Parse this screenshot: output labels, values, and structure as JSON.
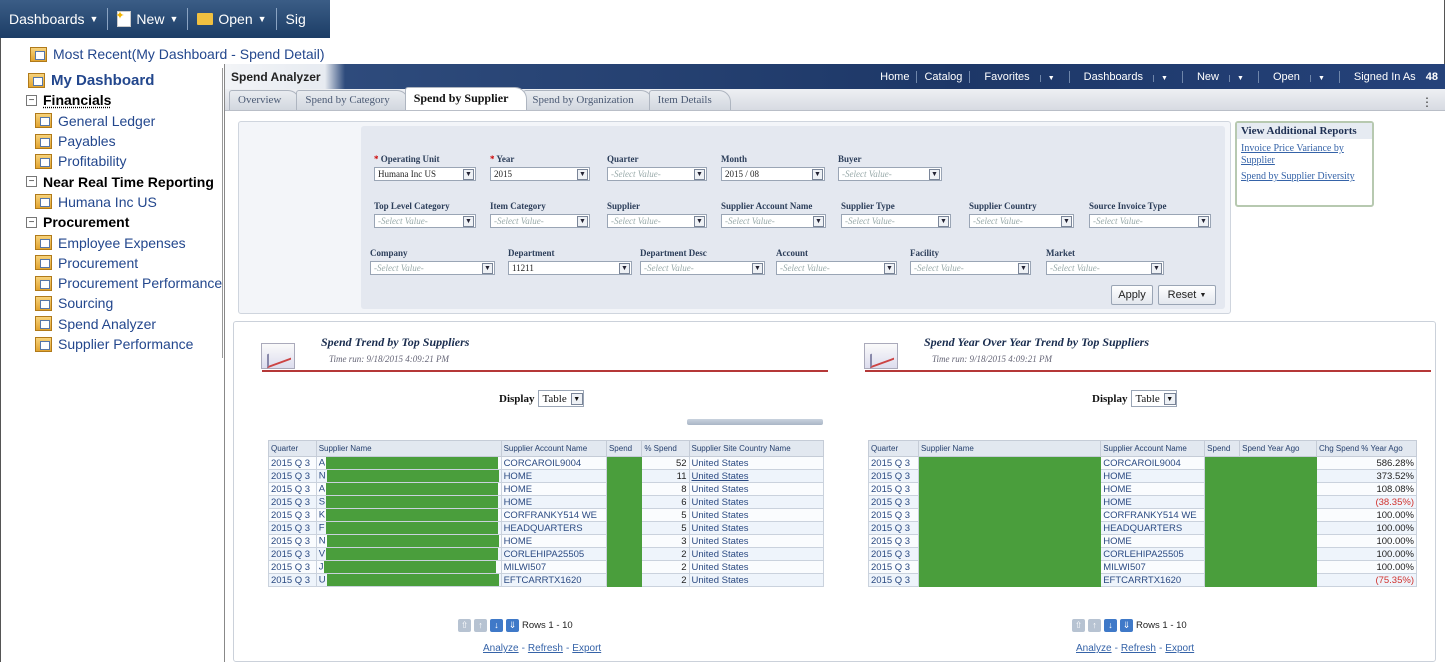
{
  "toolbar": {
    "dashboards": "Dashboards",
    "new": "New",
    "open": "Open",
    "signed_in": "Sig"
  },
  "most_recent": "Most Recent(My Dashboard - Spend Detail)",
  "tree": {
    "my_dashboard": "My Dashboard",
    "groups": [
      {
        "label": "Financials",
        "items": [
          "General Ledger",
          "Payables",
          "Profitability"
        ]
      },
      {
        "label": "Near Real Time Reporting",
        "items": [
          "Humana Inc US"
        ]
      },
      {
        "label": "Procurement",
        "items": [
          "Employee Expenses",
          "Procurement",
          "Procurement Performance",
          "Sourcing",
          "Spend Analyzer",
          "Supplier Performance"
        ]
      }
    ]
  },
  "analyzer": {
    "title": "Spend Analyzer",
    "nav": {
      "home": "Home",
      "catalog": "Catalog",
      "favorites": "Favorites",
      "dashboards": "Dashboards",
      "new": "New",
      "open": "Open",
      "signed_in": "Signed In As",
      "user_fragment": "48"
    },
    "tabs": [
      "Overview",
      "Spend by Category",
      "Spend by Supplier",
      "Spend by Organization",
      "Item Details"
    ],
    "active_tab": "Spend by Supplier"
  },
  "prompts": {
    "placeholder": "-Select Value-",
    "row1": [
      {
        "label": "Operating Unit",
        "required": "*",
        "value": "Humana Inc US"
      },
      {
        "label": "Year",
        "required": "*",
        "value": "2015"
      },
      {
        "label": "Quarter",
        "value": "-Select Value-"
      },
      {
        "label": "Month",
        "value": "2015 / 08"
      },
      {
        "label": "Buyer",
        "value": "-Select Value-"
      }
    ],
    "row2": [
      {
        "label": "Top Level Category",
        "value": "-Select Value-"
      },
      {
        "label": "Item Category",
        "value": "-Select Value-"
      },
      {
        "label": "Supplier",
        "value": "-Select Value-"
      },
      {
        "label": "Supplier Account Name",
        "value": "-Select Value-"
      },
      {
        "label": "Supplier Type",
        "value": "-Select Value-"
      },
      {
        "label": "Supplier Country",
        "value": "-Select Value-"
      },
      {
        "label": "Source Invoice Type",
        "value": "-Select Value-"
      }
    ],
    "row3": [
      {
        "label": "Company",
        "value": "-Select Value-"
      },
      {
        "label": "Department",
        "value": "11211"
      },
      {
        "label": "Department Desc",
        "value": "-Select Value-"
      },
      {
        "label": "Account",
        "value": "-Select Value-"
      },
      {
        "label": "Facility",
        "value": "-Select Value-"
      },
      {
        "label": "Market",
        "value": "-Select Value-"
      }
    ],
    "apply": "Apply",
    "reset": "Reset"
  },
  "additional_reports": {
    "title": "View Additional Reports",
    "links": [
      "Invoice Price Variance by Supplier",
      "Spend by Supplier Diversity"
    ]
  },
  "report_left": {
    "title": "Spend Trend by Top Suppliers",
    "time_run": "Time run: 9/18/2015 4:09:21 PM",
    "display_label": "Display",
    "display_value": "Table",
    "columns": [
      "Quarter",
      "Supplier Name",
      "Supplier Account Name",
      "Spend",
      "% Spend",
      "Supplier Site Country Name"
    ],
    "rows": [
      [
        "2015 Q 3",
        "A",
        "CORCAROIL9004",
        "52",
        "United States"
      ],
      [
        "2015 Q 3",
        "N",
        "HOME",
        "11",
        "United States"
      ],
      [
        "2015 Q 3",
        "A",
        "HOME",
        "8",
        "United States"
      ],
      [
        "2015 Q 3",
        "S",
        "HOME",
        "6",
        "United States"
      ],
      [
        "2015 Q 3",
        "K",
        "CORFRANKY514 WE",
        "5",
        "United States"
      ],
      [
        "2015 Q 3",
        "F",
        "HEADQUARTERS",
        "5",
        "United States"
      ],
      [
        "2015 Q 3",
        "N",
        "HOME",
        "3",
        "United States"
      ],
      [
        "2015 Q 3",
        "V",
        "CORLEHIPA25505",
        "2",
        "United States"
      ],
      [
        "2015 Q 3",
        "J",
        "MILWI507",
        "2",
        "United States"
      ],
      [
        "2015 Q 3",
        "U",
        "EFTCARRTX1620",
        "2",
        "United States"
      ]
    ],
    "rows_label": "Rows 1 - 10",
    "links": [
      "Analyze",
      "Refresh",
      "Export"
    ]
  },
  "report_right": {
    "title": "Spend Year Over Year Trend by Top Suppliers",
    "time_run": "Time run: 9/18/2015 4:09:21 PM",
    "display_label": "Display",
    "display_value": "Table",
    "columns": [
      "Quarter",
      "Supplier Name",
      "Supplier Account Name",
      "Spend",
      "Spend Year Ago",
      "Chg Spend % Year Ago"
    ],
    "rows": [
      [
        "2015 Q 3",
        "CORCAROIL9004",
        "586.28%"
      ],
      [
        "2015 Q 3",
        "HOME",
        "373.52%"
      ],
      [
        "2015 Q 3",
        "HOME",
        "108.08%"
      ],
      [
        "2015 Q 3",
        "HOME",
        "(38.35%)"
      ],
      [
        "2015 Q 3",
        "CORFRANKY514 WE",
        "100.00%"
      ],
      [
        "2015 Q 3",
        "HEADQUARTERS",
        "100.00%"
      ],
      [
        "2015 Q 3",
        "HOME",
        "100.00%"
      ],
      [
        "2015 Q 3",
        "CORLEHIPA25505",
        "100.00%"
      ],
      [
        "2015 Q 3",
        "MILWI507",
        "100.00%"
      ],
      [
        "2015 Q 3",
        "EFTCARRTX1620",
        "(75.35%)"
      ]
    ],
    "rows_label": "Rows 1 - 10",
    "links": [
      "Analyze",
      "Refresh",
      "Export"
    ]
  },
  "colors": {
    "redaction": "#4a9e3c",
    "header_blue": "#1d3767",
    "negative": "#d0312d"
  }
}
